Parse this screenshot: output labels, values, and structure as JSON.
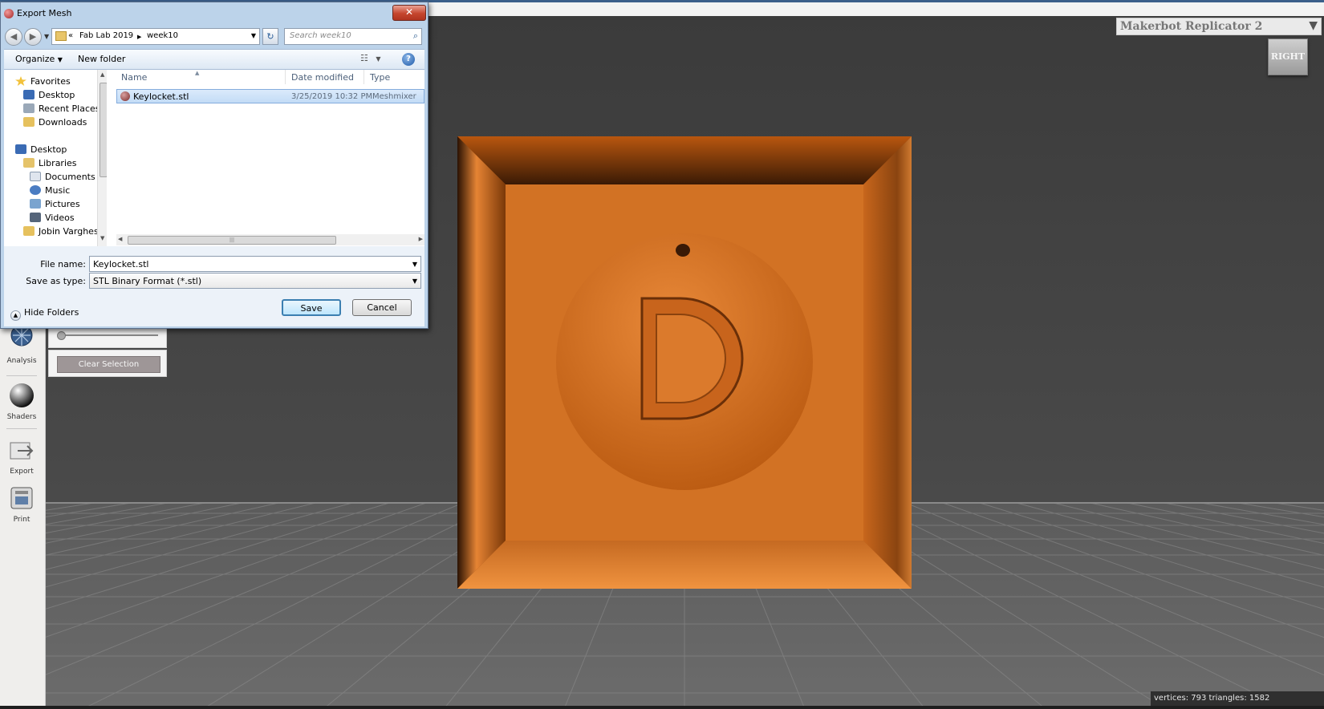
{
  "viewport": {
    "printer_selector": {
      "label": "Makerbot Replicator 2"
    },
    "view_cube_label": "RIGHT",
    "status": "vertices: 793 triangles: 1582",
    "model_color": "#d9701f"
  },
  "left_toolbar": {
    "items": [
      {
        "label": "Analysis",
        "icon": "analysis-icon"
      },
      {
        "label": "Shaders",
        "icon": "shaders-icon"
      },
      {
        "label": "Export",
        "icon": "export-icon"
      },
      {
        "label": "Print",
        "icon": "print-icon"
      }
    ]
  },
  "tool_panel": {
    "clear_selection_label": "Clear Selection"
  },
  "dialog": {
    "title": "Export Mesh",
    "breadcrumb": [
      "Fab Lab 2019",
      "week10"
    ],
    "breadcrumb_overflow": "«",
    "search_placeholder": "Search week10",
    "toolbar": {
      "organize": "Organize",
      "new_folder": "New folder"
    },
    "nav_tree": [
      {
        "label": "Favorites",
        "icon": "star-icon"
      },
      {
        "label": "Desktop",
        "icon": "desktop-icon"
      },
      {
        "label": "Recent Places",
        "icon": "recent-places-icon"
      },
      {
        "label": "Downloads",
        "icon": "downloads-icon"
      },
      {
        "label": "Desktop",
        "icon": "desktop-icon"
      },
      {
        "label": "Libraries",
        "icon": "libraries-icon"
      },
      {
        "label": "Documents",
        "icon": "documents-icon"
      },
      {
        "label": "Music",
        "icon": "music-icon"
      },
      {
        "label": "Pictures",
        "icon": "pictures-icon"
      },
      {
        "label": "Videos",
        "icon": "videos-icon"
      },
      {
        "label": "Jobin Varghese",
        "icon": "user-folder-icon"
      }
    ],
    "columns": {
      "name": "Name",
      "date": "Date modified",
      "type": "Type"
    },
    "files": [
      {
        "name": "Keylocket.stl",
        "date": "3/25/2019 10:32 PM",
        "type": "Meshmixer"
      }
    ],
    "filename_label": "File name:",
    "filename_value": "Keylocket.stl",
    "savetype_label": "Save as type:",
    "savetype_value": "STL Binary Format (*.stl)",
    "hide_folders": "Hide Folders",
    "save": "Save",
    "cancel": "Cancel"
  }
}
